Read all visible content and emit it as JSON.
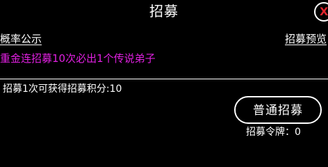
{
  "header": {
    "title": "招募",
    "close_label": "X"
  },
  "links": {
    "probability": "概率公示",
    "preview": "招募预览"
  },
  "notice": "重金连招募10次必出1个传说弟子",
  "points_text": "招募1次可获得招募积分:10",
  "recruit_button": "普通招募",
  "token": {
    "label": "招募令牌：",
    "value": "0"
  },
  "colors": {
    "background": "#000000",
    "text": "#ffffff",
    "notice": "#e020e0",
    "close_x": "#e0242d"
  }
}
